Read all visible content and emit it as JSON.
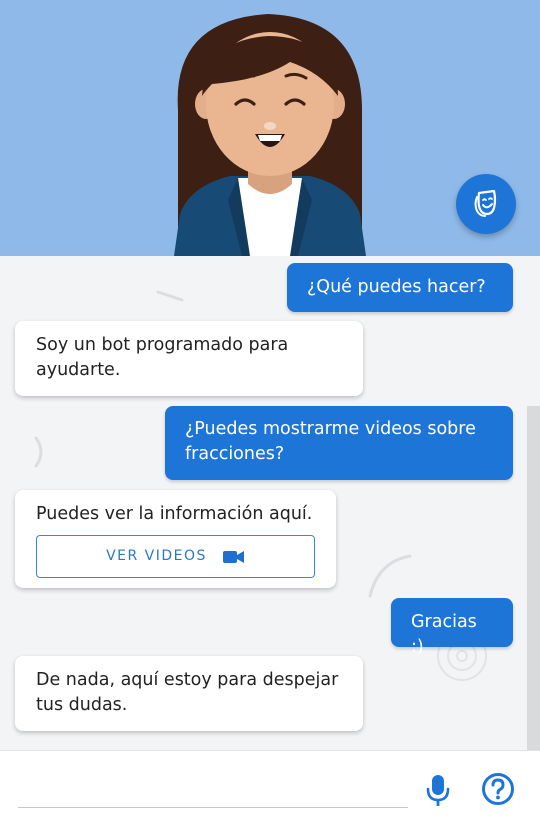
{
  "colors": {
    "header_bg": "#8fb9e8",
    "accent": "#1e75d8",
    "user_bubble": "#1e75d8",
    "bot_bubble": "#ffffff",
    "chat_bg": "#f3f4f6"
  },
  "header": {
    "avatar_icon": "woman-avatar-smiling",
    "mask_button_icon": "theater-mask-icon"
  },
  "messages": [
    {
      "from": "user",
      "text": "¿Qué puedes hacer?"
    },
    {
      "from": "bot",
      "text": "Soy un bot programado para ayudarte."
    },
    {
      "from": "user",
      "text": "¿Puedes mostrarme videos sobre fracciones?"
    },
    {
      "from": "bot",
      "text": "Puedes ver la información aquí.",
      "button": {
        "label": "VER VIDEOS",
        "icon": "video-camera-icon"
      }
    },
    {
      "from": "user",
      "text": "Gracias :)"
    },
    {
      "from": "bot",
      "text": "De nada, aquí estoy para despejar tus dudas."
    }
  ],
  "input": {
    "value": "",
    "placeholder": "",
    "mic_icon": "microphone-icon",
    "help_icon": "help-circle-icon"
  }
}
